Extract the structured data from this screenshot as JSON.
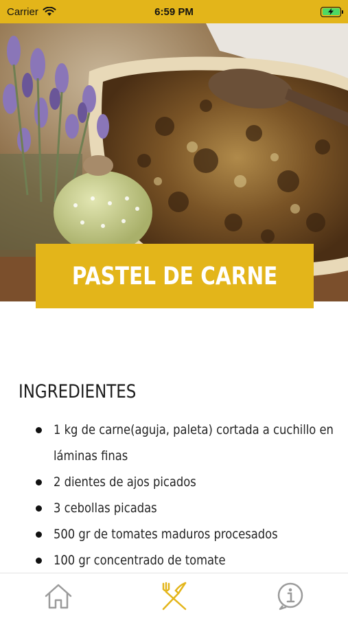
{
  "status_bar": {
    "carrier": "Carrier",
    "time": "6:59 PM",
    "battery_icon": "battery-charging-icon",
    "wifi_icon": "wifi-icon"
  },
  "colors": {
    "accent": "#e3b51a",
    "title_text": "#ffffff",
    "icon_inactive": "#9a9a9a",
    "icon_active": "#e3b51a"
  },
  "recipe": {
    "title": "PASTEL DE CARNE",
    "section_title": "INGREDIENTES",
    "ingredients": [
      "1 kg de carne(aguja, paleta) cortada a cuchillo en láminas finas",
      "2 dientes de ajos picados",
      "3 cebollas picadas",
      "500 gr de tomates maduros procesados",
      "100 gr concentrado de tomate"
    ]
  },
  "tab_bar": {
    "tabs": [
      {
        "icon": "home-icon",
        "active": false
      },
      {
        "icon": "fork-knife-icon",
        "active": true
      },
      {
        "icon": "info-icon",
        "active": false
      }
    ]
  }
}
